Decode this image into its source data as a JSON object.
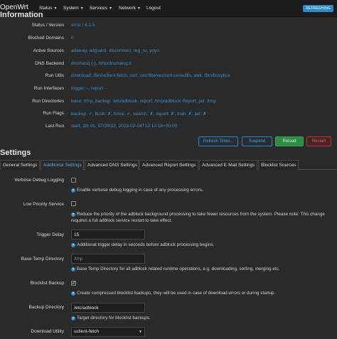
{
  "header": {
    "brand": "OpenWrt",
    "nav": [
      "Status",
      "System",
      "Services",
      "Network"
    ],
    "logout": "Logout",
    "badge": "REFRESHING"
  },
  "information": {
    "title": "Information",
    "rows": [
      {
        "label": "Status / Version",
        "value": "error / 4.1.5"
      },
      {
        "label": "Blocked Domains",
        "value": "0"
      },
      {
        "label": "Active Sources",
        "value": "adaway, adguard, disconnect, reg_ru, yoyo"
      },
      {
        "label": "DNS Backend",
        "value": "dnsmasq (-), /tmp/dnsmasq.d"
      },
      {
        "label": "Run Utils",
        "value": "download: /bin/uclient-fetch, sort: /usr/libexec/sort-coreutils, awk: /bin/busybox"
      },
      {
        "label": "Run Interfaces",
        "value": "trigger: -, report: -"
      },
      {
        "label": "Run Directories",
        "value": "base: /tmp, backup: /etc/adblock, report: /tmp/adblock-Report, jail: /tmp"
      },
      {
        "label": "Run Flags",
        "value": "backup: ✓, flush: ✗, force: ✓, search: ✗, report: ✗, mail: ✗, jail: ✗"
      },
      {
        "label": "Last Run",
        "value": "start, 2m 0s, 57/29/22, 2023-02-04T12:13:18+00:00"
      }
    ]
  },
  "actions": {
    "refresh_timer": "Refresh Timer...",
    "suspend": "Suspend",
    "reload": "Reload",
    "restart": "Restart"
  },
  "settings": {
    "title": "Settings",
    "tabs": [
      "General Settings",
      "Additional Settings",
      "Advanced DNS Settings",
      "Advanced Report Settings",
      "Advanced E-Mail Settings",
      "Blocklist Sources"
    ],
    "active_tab": "Additional Settings",
    "fields": {
      "verbose_label": "Verbose Debug Logging",
      "verbose_help": "Enable verbose debug logging in case of any processing errors.",
      "lowprio_label": "Low Priority Service",
      "lowprio_help": "Reduce the priority of the adblock background processing to take fewer resources from the system. Please note: This change requires a full adblock service restart to take effect.",
      "trigger_label": "Trigger Delay",
      "trigger_value": "15",
      "trigger_help": "Additional trigger delay in seconds before adblock processing begins.",
      "basetemp_label": "Base Temp Directory",
      "basetemp_placeholder": "/tmp",
      "basetemp_help": "Base Temp Directory for all adblock related runtime operations, e.g. downloading, sorting, merging etc.",
      "backup_label": "Blocklist Backup",
      "backup_checked": true,
      "backup_help": "Create compressed blocklist backups, they will be used in case of download errors or during startup.",
      "backupdir_label": "Backup Directory",
      "backupdir_value": "/etc/adblock",
      "backupdir_help": "Target directory for blocklist backups.",
      "download_label": "Download Utility",
      "download_value": "uclient-fetch"
    }
  }
}
